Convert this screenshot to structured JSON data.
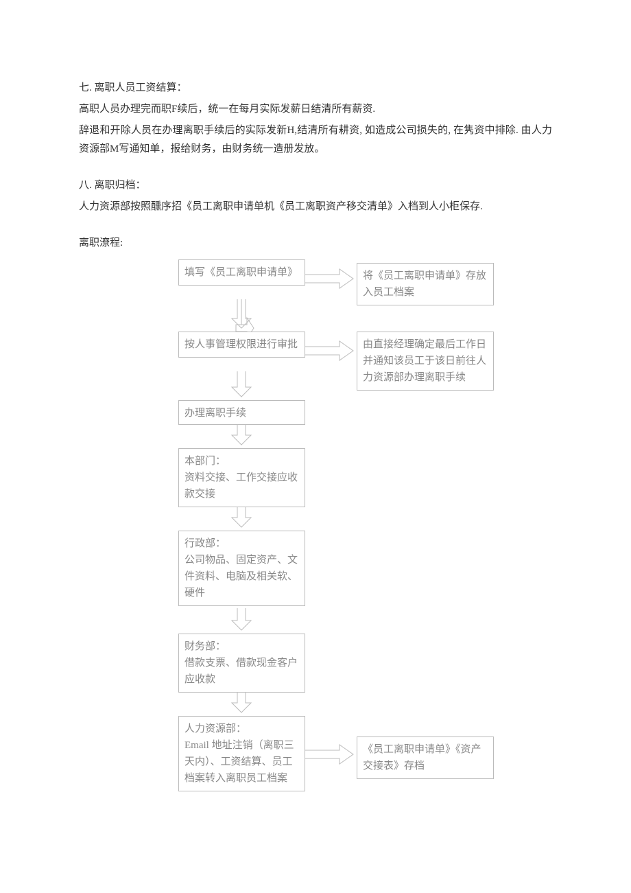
{
  "paragraphs": {
    "p1": "七. 离职人员工资结算：",
    "p2": "高职人员办理完而职F续后，统一在每月实际发薪日结清所有薪资.",
    "p3": "辞退和开除人员在办理离职手续后的实际发新H,结清所有耕资, 如造成公司损失的, 在隽资中排除. 由人力资源部M写通知单，报给财务，由财务统一造册发放。",
    "p4": "八. 离职归档：",
    "p5": "人力资源部按照醺序招《员工离职申请单机《员工离职资产移交清单》入档到人小柜保存.",
    "p6": "离职潦程:"
  },
  "flow": {
    "b1": "填写《员工离职申请单》",
    "b2": "按人事管理权限进行审批",
    "b3": "办理离职手续",
    "b4": "本部门：\n资料交接、工作交接应收款交接",
    "b5": "行政部：\n公司物品、固定资产、文件资料、电脑及相关软、硬件",
    "b6": "财务部：\n借款支票、借款现金客户应收款",
    "b7": "人力资源部：\nEmail 地址注销（离职三天内）、工资结算、员工档案转入离职员工档案",
    "r1": "将《员工离职申请单》存放入员工档案",
    "r2": "由直接经理确定最后工作日并通知该员工于该日前往人力资源部办理离职手续",
    "r3": "《员工离职申请单》《资产交接表》存档"
  }
}
